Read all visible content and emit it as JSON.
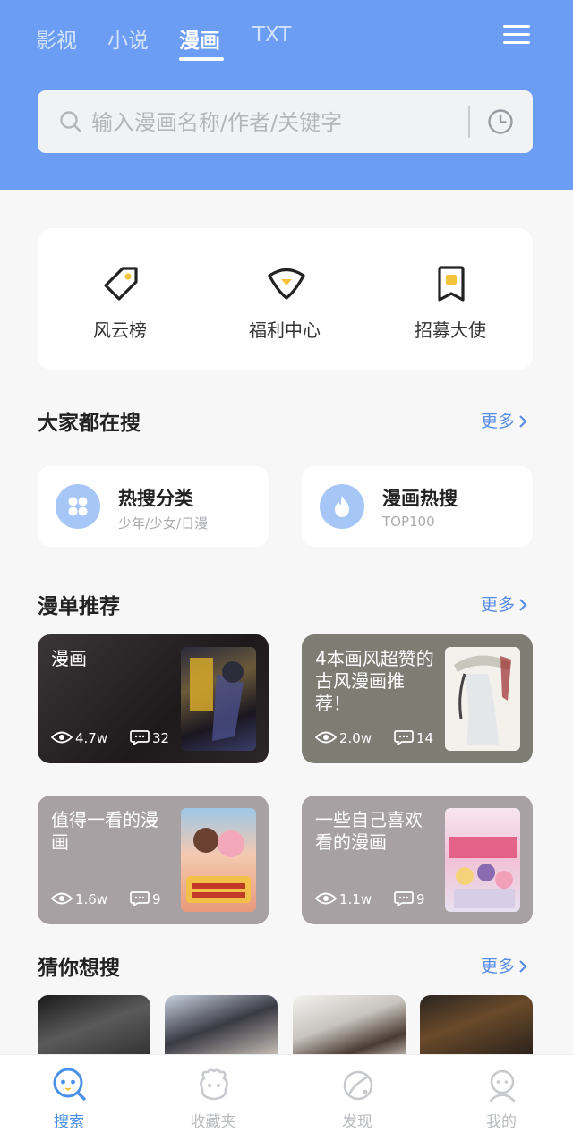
{
  "header": {
    "tabs": [
      {
        "label": "影视",
        "active": false
      },
      {
        "label": "小说",
        "active": false
      },
      {
        "label": "漫画",
        "active": true
      },
      {
        "label": "TXT",
        "active": false
      }
    ],
    "menu_icon": "menu-icon",
    "search": {
      "placeholder": "输入漫画名称/作者/关键字",
      "value": "",
      "history_icon": "clock-icon"
    },
    "bg_color": "#6b9df5"
  },
  "quick_links": [
    {
      "label": "风云榜",
      "icon": "tag-icon"
    },
    {
      "label": "福利中心",
      "icon": "gem-icon"
    },
    {
      "label": "招募大使",
      "icon": "bookmark-icon"
    }
  ],
  "popular": {
    "title": "大家都在搜",
    "more": "更多",
    "cards": [
      {
        "title": "热搜分类",
        "subtitle": "少年/少女/日漫",
        "icon": "grid-icon"
      },
      {
        "title": "漫画热搜",
        "subtitle": "TOP100",
        "icon": "flame-icon"
      }
    ]
  },
  "recommend": {
    "title": "漫单推荐",
    "more": "更多",
    "cards": [
      {
        "title": "漫画",
        "views": "4.7w",
        "comments": "32",
        "bg": "#2a2729"
      },
      {
        "title": "4本画风超赞的古风漫画推荐！",
        "views": "2.0w",
        "comments": "14",
        "bg": "#7e7d74"
      },
      {
        "title": "值得一看的漫画",
        "views": "1.6w",
        "comments": "9",
        "bg": "#a8a1a3"
      },
      {
        "title": "一些自己喜欢看的漫画",
        "views": "1.1w",
        "comments": "9",
        "bg": "#a8a1a3"
      }
    ]
  },
  "guess": {
    "title": "猜你想搜",
    "more": "更多"
  },
  "tabbar": [
    {
      "label": "搜索",
      "icon": "search-face-icon",
      "active": true
    },
    {
      "label": "收藏夹",
      "icon": "favorites-icon",
      "active": false
    },
    {
      "label": "发现",
      "icon": "planet-icon",
      "active": false
    },
    {
      "label": "我的",
      "icon": "profile-icon",
      "active": false
    }
  ],
  "colors": {
    "accent": "#4a90e8",
    "more_link": "#5a8ee6",
    "highlight": "#f5c33b"
  }
}
